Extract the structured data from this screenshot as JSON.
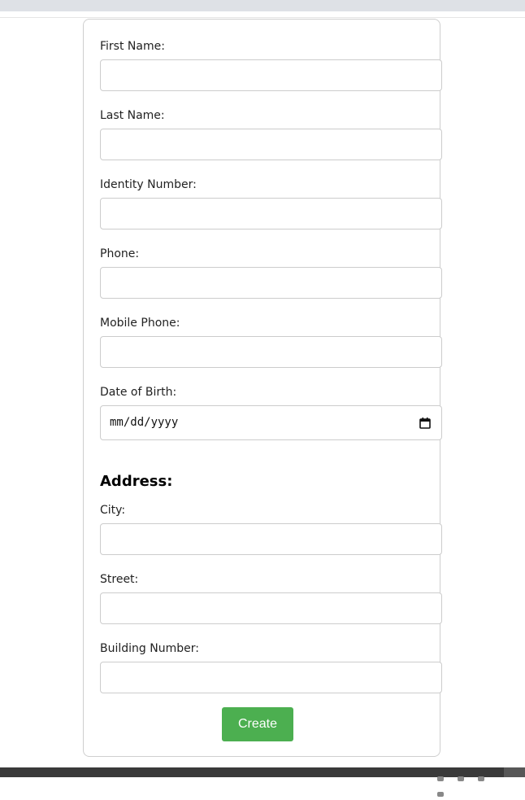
{
  "form": {
    "first_name": {
      "label": "First Name:",
      "value": ""
    },
    "last_name": {
      "label": "Last Name:",
      "value": ""
    },
    "identity_number": {
      "label": "Identity Number:",
      "value": ""
    },
    "phone": {
      "label": "Phone:",
      "value": ""
    },
    "mobile_phone": {
      "label": "Mobile Phone:",
      "value": ""
    },
    "date_of_birth": {
      "label": "Date of Birth:",
      "placeholder": "mm/dd/yyyy",
      "icon": "calendar-icon"
    },
    "address_heading": "Address:",
    "city": {
      "label": "City:",
      "value": ""
    },
    "street": {
      "label": "Street:",
      "value": ""
    },
    "building_number": {
      "label": "Building Number:",
      "value": ""
    },
    "submit_label": "Create"
  },
  "colors": {
    "button_bg": "#4caf50",
    "button_text": "#ffffff",
    "input_border": "#cccccc",
    "card_border": "#cfcfcf"
  }
}
